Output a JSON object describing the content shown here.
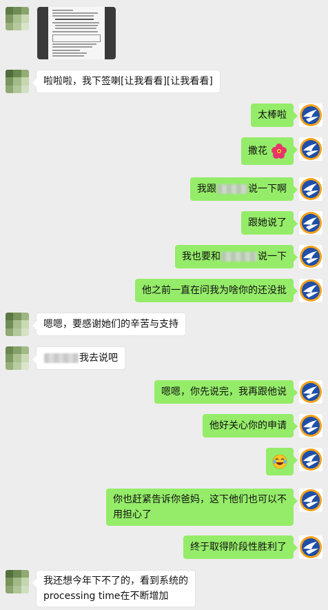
{
  "messages": [
    {
      "side": "other",
      "type": "image",
      "content": "document-thumbnail"
    },
    {
      "side": "other",
      "type": "text",
      "text": "啦啦啦，我下签喇[让我看看][让我看看]"
    },
    {
      "side": "self",
      "type": "text",
      "text": "太棒啦"
    },
    {
      "side": "self",
      "type": "text",
      "text": "撒花",
      "emoji": "hibiscus-flower"
    },
    {
      "side": "self",
      "type": "text",
      "pre": "我跟",
      "post": "说一下啊",
      "redacted": true
    },
    {
      "side": "self",
      "type": "text",
      "text": "跟她说了"
    },
    {
      "side": "self",
      "type": "text",
      "pre": "我也要和",
      "post": "说一下",
      "redacted": true
    },
    {
      "side": "self",
      "type": "text",
      "text": "他之前一直在问我为啥你的还没批"
    },
    {
      "side": "other",
      "type": "text",
      "text": "嗯嗯，要感谢她们的辛苦与支持"
    },
    {
      "side": "other",
      "type": "text",
      "pre": "",
      "post": "我去说吧",
      "redacted": true
    },
    {
      "side": "self",
      "type": "text",
      "text": "嗯嗯，你先说完，我再跟他说"
    },
    {
      "side": "self",
      "type": "text",
      "text": "他好关心你的申请"
    },
    {
      "side": "self",
      "type": "emoji",
      "emoji": "laughing-tears-emoji"
    },
    {
      "side": "self",
      "type": "text",
      "lines": [
        "你也赶紧告诉你爸妈，这下他们也可以不",
        "用担心了"
      ]
    },
    {
      "side": "self",
      "type": "text",
      "text": "终于取得阶段性胜利了"
    },
    {
      "side": "other",
      "type": "text",
      "lines": [
        "我还想今年下不了的，看到系统的",
        "processing time在不断增加"
      ]
    }
  ],
  "colors": {
    "background": "#ededed",
    "self_bubble": "#95ec69",
    "other_bubble": "#ffffff",
    "self_avatar_bg": "#1f4fa8",
    "self_avatar_ring": "#f3a21b"
  },
  "avatars": {
    "other": "mosaic-avatar",
    "self": "bird-logo-avatar"
  }
}
